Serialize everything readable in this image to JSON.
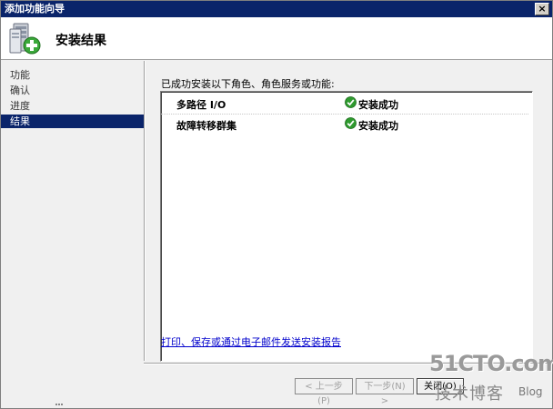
{
  "window": {
    "title": "添加功能向导",
    "close_label": "×"
  },
  "header": {
    "title": "安装结果"
  },
  "nav": {
    "items": [
      {
        "label": "功能",
        "active": false
      },
      {
        "label": "确认",
        "active": false
      },
      {
        "label": "进度",
        "active": false
      },
      {
        "label": "结果",
        "active": true
      }
    ]
  },
  "main": {
    "heading": "已成功安装以下角色、角色服务或功能:",
    "results": [
      {
        "name": "多路径 I/O",
        "status": "安装成功"
      },
      {
        "name": "故障转移群集",
        "status": "安装成功"
      }
    ],
    "report_link": "打印、保存或通过电子邮件发送安装报告"
  },
  "buttons": {
    "prev": "< 上一步(P)",
    "next": "下一步(N) >",
    "close": "关闭(O)"
  },
  "watermark": {
    "site": "51CTO.com",
    "subtitle": "技术博客",
    "blog": "Blog"
  },
  "colors": {
    "titlebar": "#0a246a",
    "selection": "#0a246a",
    "link": "#0000cc",
    "success": "#2e9a2e"
  }
}
